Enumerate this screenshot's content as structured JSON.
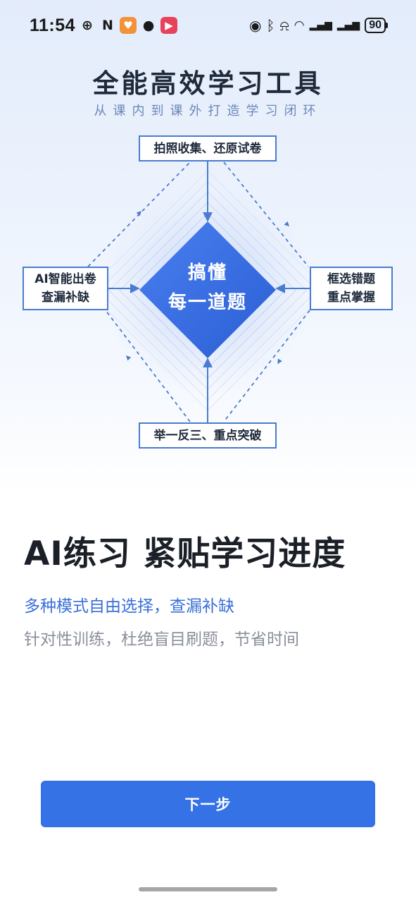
{
  "status_bar": {
    "time": "11:54",
    "left_icons": [
      {
        "name": "speed-icon",
        "glyph": "⊕",
        "bg": "transparent",
        "color": "#1a1a1a"
      },
      {
        "name": "nfc-icon",
        "glyph": "N",
        "bg": "transparent",
        "color": "#1a1a1a"
      },
      {
        "name": "app-heart-icon",
        "glyph": "♥",
        "bg": "#f2933a",
        "color": "#ffffff"
      },
      {
        "name": "wechat-icon",
        "glyph": "●",
        "bg": "transparent",
        "color": "#1a1a1a"
      },
      {
        "name": "video-play-icon",
        "glyph": "▶",
        "bg": "#e8425a",
        "color": "#ffffff"
      }
    ],
    "right_icons": [
      {
        "name": "alarm-icon",
        "glyph": "⏰"
      },
      {
        "name": "bluetooth-icon",
        "glyph": "ᛒ"
      },
      {
        "name": "mute-bell-icon",
        "glyph": "🔕"
      },
      {
        "name": "wifi-icon",
        "glyph": "⁶ᯤ"
      },
      {
        "name": "signal-5g-1-icon",
        "glyph": "⁵ᴳ▂▄▆"
      },
      {
        "name": "signal-5g-2-icon",
        "glyph": "⁵ᴳ▂▄▆"
      }
    ],
    "battery": "90"
  },
  "hero": {
    "title": "全能高效学习工具",
    "subtitle": "从课内到课外打造学习闭环"
  },
  "diagram": {
    "top": "拍照收集、还原试卷",
    "right_line1": "框选错题",
    "right_line2": "重点掌握",
    "bottom": "举一反三、重点突破",
    "left_line1": "AI智能出卷",
    "left_line2": "查漏补缺",
    "center_line1": "搞懂",
    "center_line2": "每一道题"
  },
  "content": {
    "heading": "AI练习 紧贴学习进度",
    "highlight": "多种模式自由选择，查漏补缺",
    "description": "针对性训练，杜绝盲目刷题，节省时间"
  },
  "next_button": "下一步",
  "colors": {
    "accent": "#3472e6",
    "diamond": "#3569df",
    "highlight_text": "#3a6fd8"
  }
}
